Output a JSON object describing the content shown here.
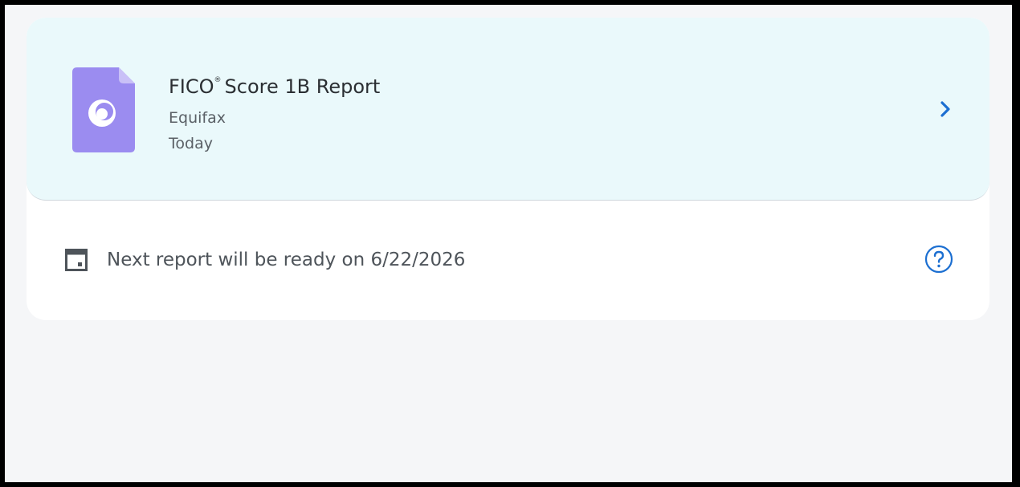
{
  "report": {
    "title_prefix": "FICO",
    "title_mark": "®",
    "title_suffix": "Score 1B Report",
    "bureau": "Equifax",
    "date": "Today",
    "icon": "document-icon",
    "chevron_icon": "chevron-right-icon"
  },
  "next_report": {
    "text": "Next report will be ready on 6/22/2026",
    "calendar_icon": "calendar-icon",
    "help_icon": "help-icon"
  },
  "colors": {
    "accent": "#1c6fd1",
    "doc_icon": "#9b8cf0",
    "card_highlight": "#eaf9fb",
    "page_bg": "#f5f6f8"
  }
}
